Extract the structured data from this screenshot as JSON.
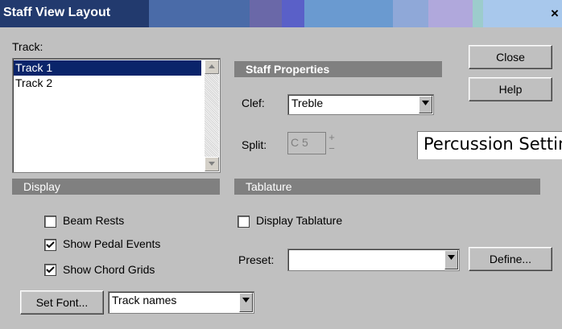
{
  "window": {
    "title": "Staff View Layout",
    "close_glyph": "×"
  },
  "track": {
    "label": "Track:",
    "items": [
      {
        "label": "Track 1",
        "selected": true
      },
      {
        "label": "Track 2",
        "selected": false
      }
    ]
  },
  "buttons": {
    "close": "Close",
    "help": "Help",
    "percussion": "Percussion Setting",
    "define": "Define...",
    "set_font": "Set Font..."
  },
  "staff_properties": {
    "header": "Staff Properties",
    "clef_label": "Clef:",
    "clef_value": "Treble",
    "split_label": "Split:",
    "split_value": "C 5",
    "spin_up": "+",
    "spin_down": "−"
  },
  "display": {
    "header": "Display",
    "beam_rests": {
      "label": "Beam Rests",
      "checked": false
    },
    "show_pedal_events": {
      "label": "Show Pedal Events",
      "checked": true
    },
    "show_chord_grids": {
      "label": "Show Chord Grids",
      "checked": true
    }
  },
  "tablature": {
    "header": "Tablature",
    "display_tablature": {
      "label": "Display Tablature",
      "checked": false
    },
    "preset_label": "Preset:",
    "preset_value": ""
  },
  "font_select": {
    "value": "Track names"
  },
  "colors": {
    "selection": "#0a246a",
    "section_bar": "#808080",
    "dialog_bg": "#c0c0c0"
  }
}
